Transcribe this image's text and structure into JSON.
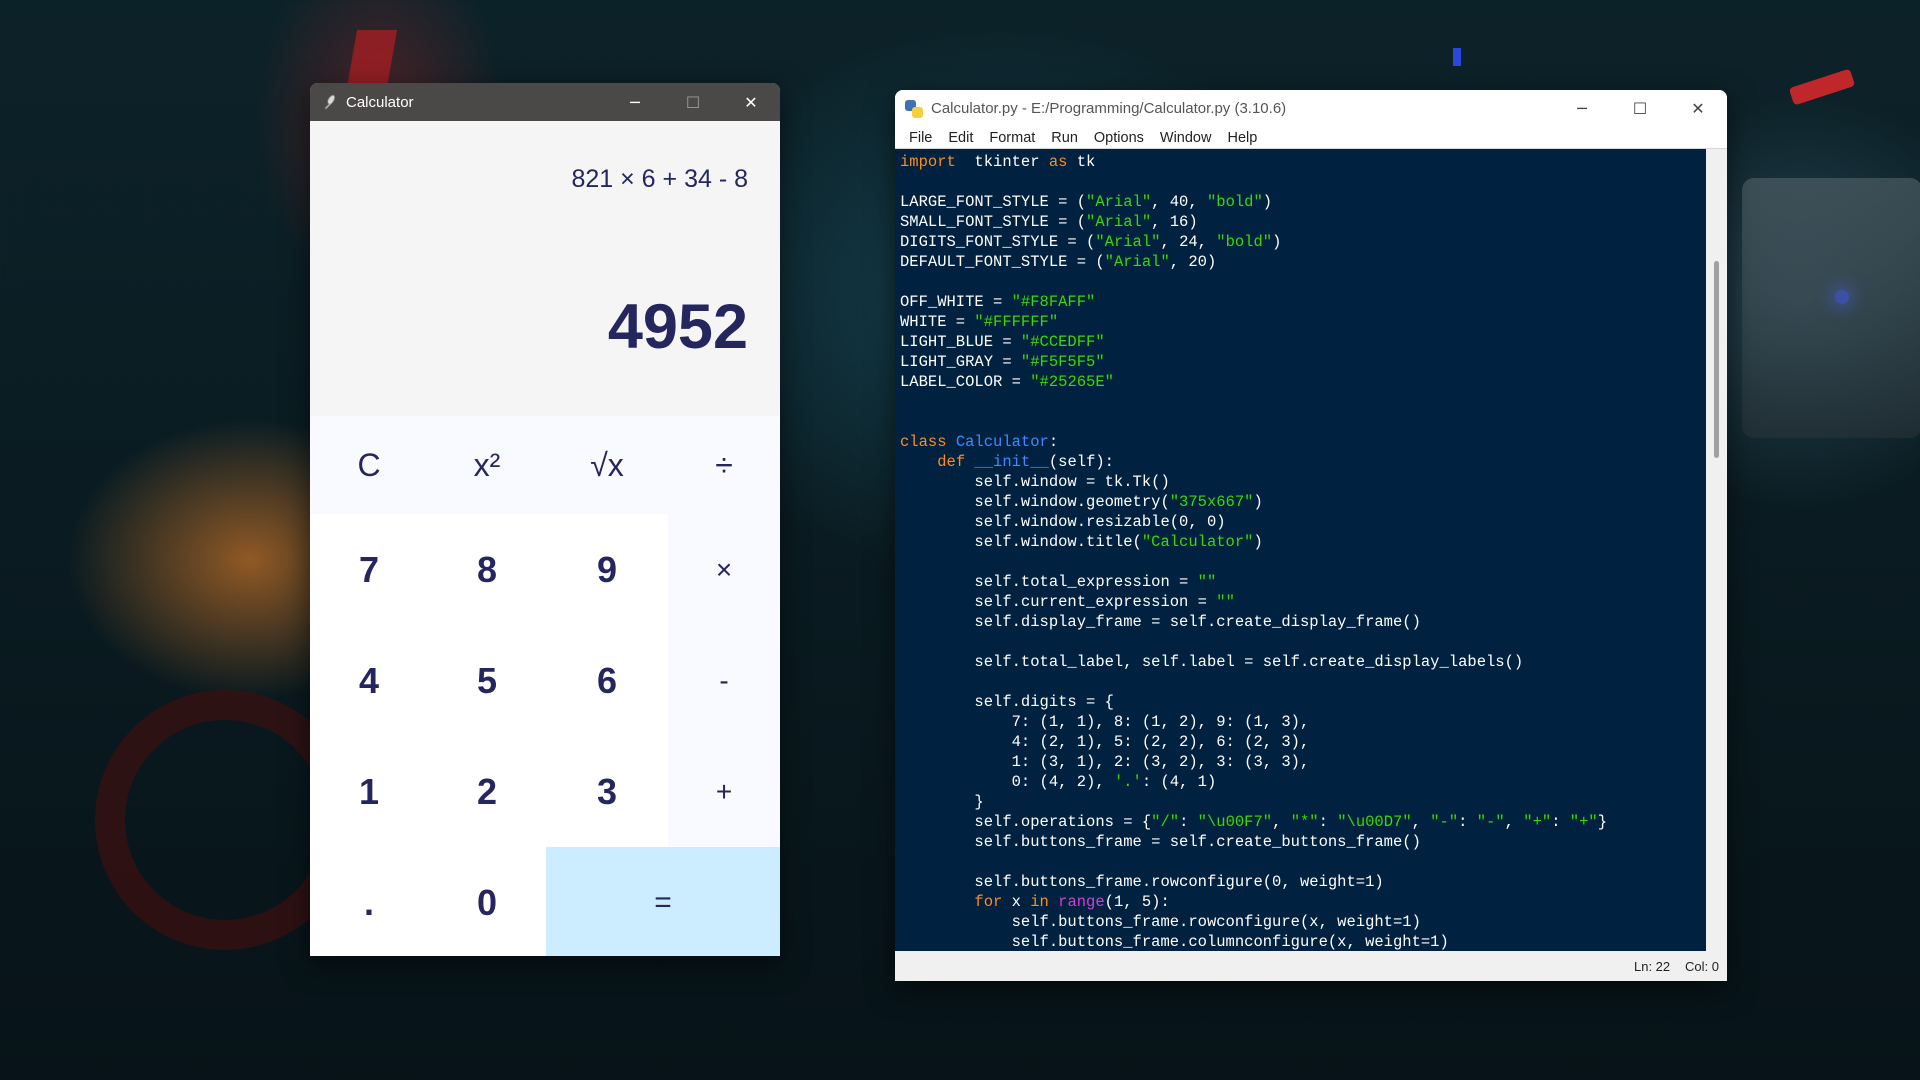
{
  "calculator": {
    "title": "Calculator",
    "controls": {
      "minimize": "─",
      "maximize": "☐",
      "close": "✕"
    },
    "total_expression": "821 × 6 + 34 - 8",
    "current_expression": "4952",
    "buttons": {
      "clear": "C",
      "square": "x²",
      "sqrt": "√x",
      "divide": "÷",
      "d7": "7",
      "d8": "8",
      "d9": "9",
      "multiply": "×",
      "d4": "4",
      "d5": "5",
      "d6": "6",
      "subtract": "-",
      "d1": "1",
      "d2": "2",
      "d3": "3",
      "add": "+",
      "dot": ".",
      "d0": "0",
      "equals": "="
    }
  },
  "idle": {
    "title": "Calculator.py - E:/Programming/Calculator.py (3.10.6)",
    "controls": {
      "minimize": "─",
      "maximize": "☐",
      "close": "✕"
    },
    "menu": [
      "File",
      "Edit",
      "Format",
      "Run",
      "Options",
      "Window",
      "Help"
    ],
    "status": {
      "line": "Ln: 22",
      "col": "Col: 0"
    },
    "code_lines": [
      [
        [
          "kw",
          "import"
        ],
        [
          "",
          "  tkinter "
        ],
        [
          "kw",
          "as"
        ],
        [
          "",
          " tk"
        ]
      ],
      [],
      [
        [
          "",
          "LARGE_FONT_STYLE = ("
        ],
        [
          "str",
          "\"Arial\""
        ],
        [
          "",
          ", 40, "
        ],
        [
          "str",
          "\"bold\""
        ],
        [
          "",
          ")"
        ]
      ],
      [
        [
          "",
          "SMALL_FONT_STYLE = ("
        ],
        [
          "str",
          "\"Arial\""
        ],
        [
          "",
          ", 16)"
        ]
      ],
      [
        [
          "",
          "DIGITS_FONT_STYLE = ("
        ],
        [
          "str",
          "\"Arial\""
        ],
        [
          "",
          ", 24, "
        ],
        [
          "str",
          "\"bold\""
        ],
        [
          "",
          ")"
        ]
      ],
      [
        [
          "",
          "DEFAULT_FONT_STYLE = ("
        ],
        [
          "str",
          "\"Arial\""
        ],
        [
          "",
          ", 20)"
        ]
      ],
      [],
      [
        [
          "",
          "OFF_WHITE = "
        ],
        [
          "str",
          "\"#F8FAFF\""
        ]
      ],
      [
        [
          "",
          "WHITE = "
        ],
        [
          "str",
          "\"#FFFFFF\""
        ]
      ],
      [
        [
          "",
          "LIGHT_BLUE = "
        ],
        [
          "str",
          "\"#CCEDFF\""
        ]
      ],
      [
        [
          "",
          "LIGHT_GRAY = "
        ],
        [
          "str",
          "\"#F5F5F5\""
        ]
      ],
      [
        [
          "",
          "LABEL_COLOR = "
        ],
        [
          "str",
          "\"#25265E\""
        ]
      ],
      [],
      [],
      [
        [
          "kw",
          "class"
        ],
        [
          "",
          " "
        ],
        [
          "fn",
          "Calculator"
        ],
        [
          "",
          ":"
        ]
      ],
      [
        [
          "",
          "    "
        ],
        [
          "kw",
          "def"
        ],
        [
          "",
          " "
        ],
        [
          "fn",
          "__init__"
        ],
        [
          "",
          "(self):"
        ]
      ],
      [
        [
          "",
          "        self.window = tk.Tk()"
        ]
      ],
      [
        [
          "",
          "        self.window.geometry("
        ],
        [
          "str",
          "\"375x667\""
        ],
        [
          "",
          ")"
        ]
      ],
      [
        [
          "",
          "        self.window.resizable(0, 0)"
        ]
      ],
      [
        [
          "",
          "        self.window.title("
        ],
        [
          "str",
          "\"Calculator\""
        ],
        [
          "",
          ")"
        ]
      ],
      [],
      [
        [
          "",
          "        self.total_expression = "
        ],
        [
          "str",
          "\"\""
        ]
      ],
      [
        [
          "",
          "        self.current_expression = "
        ],
        [
          "str",
          "\"\""
        ]
      ],
      [
        [
          "",
          "        self.display_frame = self.create_display_frame()"
        ]
      ],
      [],
      [
        [
          "",
          "        self.total_label, self.label = self.create_display_labels()"
        ]
      ],
      [],
      [
        [
          "",
          "        self.digits = {"
        ]
      ],
      [
        [
          "",
          "            7: (1, 1), 8: (1, 2), 9: (1, 3),"
        ]
      ],
      [
        [
          "",
          "            4: (2, 1), 5: (2, 2), 6: (2, 3),"
        ]
      ],
      [
        [
          "",
          "            1: (3, 1), 2: (3, 2), 3: (3, 3),"
        ]
      ],
      [
        [
          "",
          "            0: (4, 2), "
        ],
        [
          "str",
          "'.'"
        ],
        [
          "",
          ": (4, 1)"
        ]
      ],
      [
        [
          "",
          "        }"
        ]
      ],
      [
        [
          "",
          "        self.operations = {"
        ],
        [
          "str",
          "\"/\""
        ],
        [
          "",
          ": "
        ],
        [
          "str",
          "\"\\u00F7\""
        ],
        [
          "",
          ", "
        ],
        [
          "str",
          "\"*\""
        ],
        [
          "",
          ": "
        ],
        [
          "str",
          "\"\\u00D7\""
        ],
        [
          "",
          ", "
        ],
        [
          "str",
          "\"-\""
        ],
        [
          "",
          ": "
        ],
        [
          "str",
          "\"-\""
        ],
        [
          "",
          ", "
        ],
        [
          "str",
          "\"+\""
        ],
        [
          "",
          ": "
        ],
        [
          "str",
          "\"+\""
        ],
        [
          "",
          "}"
        ]
      ],
      [
        [
          "",
          "        self.buttons_frame = self.create_buttons_frame()"
        ]
      ],
      [],
      [
        [
          "",
          "        self.buttons_frame.rowconfigure(0, weight=1)"
        ]
      ],
      [
        [
          "",
          "        "
        ],
        [
          "kw",
          "for"
        ],
        [
          "",
          " x "
        ],
        [
          "kw",
          "in"
        ],
        [
          "",
          " "
        ],
        [
          "bi",
          "range"
        ],
        [
          "",
          "(1, 5):"
        ]
      ],
      [
        [
          "",
          "            self.buttons_frame.rowconfigure(x, weight=1)"
        ]
      ],
      [
        [
          "",
          "            self.buttons_frame.columnconfigure(x, weight=1)"
        ]
      ]
    ]
  }
}
